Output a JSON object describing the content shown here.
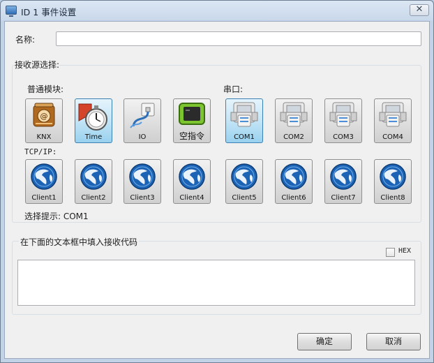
{
  "window": {
    "title": "ID 1 事件设置",
    "close_glyph": "✕"
  },
  "form": {
    "name_label": "名称:",
    "name_value": "",
    "source_label": "接收源选择:",
    "common_label": "普通模块:",
    "serial_label": "串口:",
    "tcp_label": "TCP/IP:",
    "hint": "选择提示: COM1"
  },
  "common_modules": [
    {
      "label": "KNX",
      "icon": "knx-icon"
    },
    {
      "label": "Time",
      "icon": "stopwatch-icon"
    },
    {
      "label": "IO",
      "icon": "io-icon"
    },
    {
      "label": "空指令",
      "icon": "empty-command-icon"
    }
  ],
  "serial_ports": [
    {
      "label": "COM1",
      "icon": "serial-port-icon"
    },
    {
      "label": "COM2",
      "icon": "serial-port-icon"
    },
    {
      "label": "COM3",
      "icon": "serial-port-icon"
    },
    {
      "label": "COM4",
      "icon": "serial-port-icon"
    }
  ],
  "clients": [
    {
      "label": "Client1",
      "icon": "globe-icon"
    },
    {
      "label": "Client2",
      "icon": "globe-icon"
    },
    {
      "label": "Client3",
      "icon": "globe-icon"
    },
    {
      "label": "Client4",
      "icon": "globe-icon"
    },
    {
      "label": "Client5",
      "icon": "globe-icon"
    },
    {
      "label": "Client6",
      "icon": "globe-icon"
    },
    {
      "label": "Client7",
      "icon": "globe-icon"
    },
    {
      "label": "Client8",
      "icon": "globe-icon"
    }
  ],
  "code": {
    "group_label": "在下面的文本框中填入接收代码",
    "hex_label": "HEX",
    "hex_checked": false,
    "code_value": ""
  },
  "buttons": {
    "ok": "确定",
    "cancel": "取消"
  },
  "colors": {
    "accent": "#3c7fb1",
    "selected_tile": "#c4e5f6"
  }
}
